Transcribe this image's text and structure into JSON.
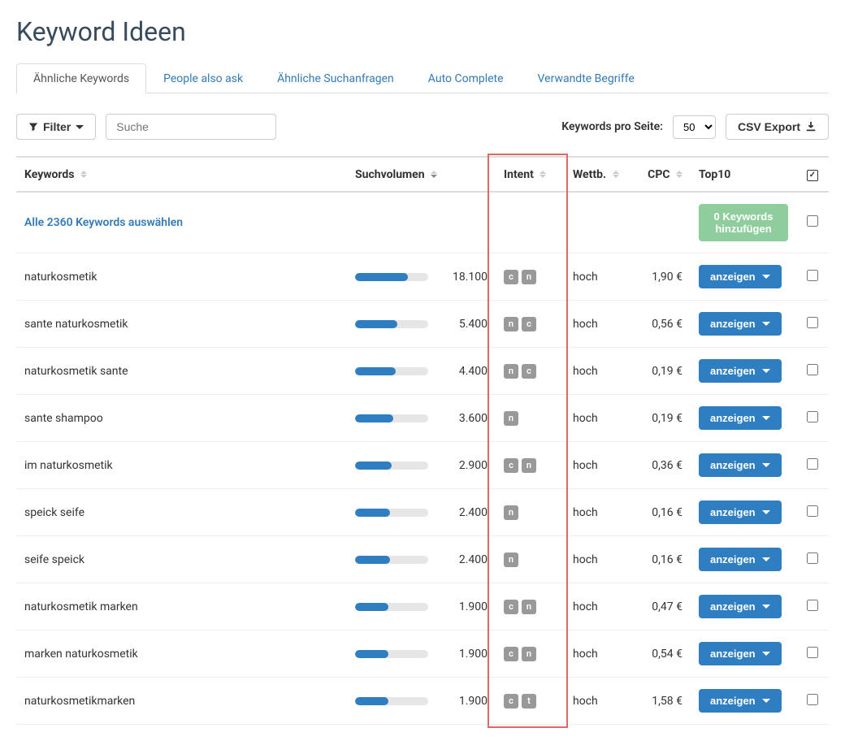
{
  "page_title": "Keyword Ideen",
  "tabs": [
    {
      "label": "Ähnliche Keywords",
      "active": true
    },
    {
      "label": "People also ask",
      "active": false
    },
    {
      "label": "Ähnliche Suchanfragen",
      "active": false
    },
    {
      "label": "Auto Complete",
      "active": false
    },
    {
      "label": "Verwandte Begriffe",
      "active": false
    }
  ],
  "toolbar": {
    "filter_label": "Filter",
    "search_placeholder": "Suche",
    "per_page_label": "Keywords pro Seite:",
    "per_page_value": "50",
    "export_label": "CSV Export"
  },
  "columns": {
    "keywords": "Keywords",
    "volume": "Suchvolumen",
    "intent": "Intent",
    "wettb": "Wettb.",
    "cpc": "CPC",
    "top10": "Top10"
  },
  "select_all": {
    "text": "Alle 2360 Keywords auswählen",
    "add_button": "0 Keywords hinzufügen"
  },
  "show_button_label": "anzeigen",
  "rows": [
    {
      "keyword": "naturkosmetik",
      "volume": "18.100",
      "bar_pct": 72,
      "intent": [
        "c",
        "n"
      ],
      "wettb": "hoch",
      "cpc": "1,90 €"
    },
    {
      "keyword": "sante naturkosmetik",
      "volume": "5.400",
      "bar_pct": 58,
      "intent": [
        "n",
        "c"
      ],
      "wettb": "hoch",
      "cpc": "0,56 €"
    },
    {
      "keyword": "naturkosmetik sante",
      "volume": "4.400",
      "bar_pct": 55,
      "intent": [
        "n",
        "c"
      ],
      "wettb": "hoch",
      "cpc": "0,19 €"
    },
    {
      "keyword": "sante shampoo",
      "volume": "3.600",
      "bar_pct": 52,
      "intent": [
        "n"
      ],
      "wettb": "hoch",
      "cpc": "0,19 €"
    },
    {
      "keyword": "im naturkosmetik",
      "volume": "2.900",
      "bar_pct": 50,
      "intent": [
        "c",
        "n"
      ],
      "wettb": "hoch",
      "cpc": "0,36 €"
    },
    {
      "keyword": "speick seife",
      "volume": "2.400",
      "bar_pct": 48,
      "intent": [
        "n"
      ],
      "wettb": "hoch",
      "cpc": "0,16 €"
    },
    {
      "keyword": "seife speick",
      "volume": "2.400",
      "bar_pct": 48,
      "intent": [
        "n"
      ],
      "wettb": "hoch",
      "cpc": "0,16 €"
    },
    {
      "keyword": "naturkosmetik marken",
      "volume": "1.900",
      "bar_pct": 45,
      "intent": [
        "c",
        "n"
      ],
      "wettb": "hoch",
      "cpc": "0,47 €"
    },
    {
      "keyword": "marken naturkosmetik",
      "volume": "1.900",
      "bar_pct": 45,
      "intent": [
        "c",
        "n"
      ],
      "wettb": "hoch",
      "cpc": "0,54 €"
    },
    {
      "keyword": "naturkosmetikmarken",
      "volume": "1.900",
      "bar_pct": 45,
      "intent": [
        "c",
        "t"
      ],
      "wettb": "hoch",
      "cpc": "1,58 €"
    }
  ]
}
